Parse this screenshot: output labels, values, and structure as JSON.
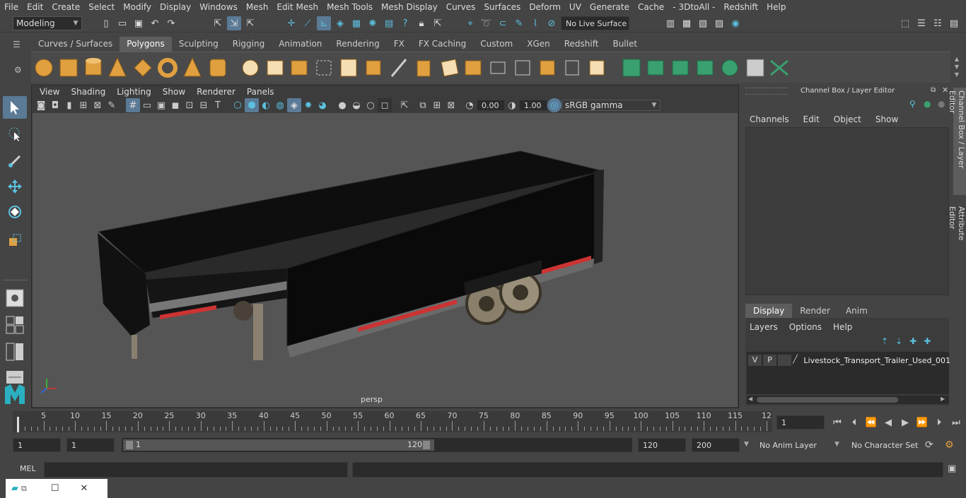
{
  "menubar": {
    "items": [
      "File",
      "Edit",
      "Create",
      "Select",
      "Modify",
      "Display",
      "Windows",
      "Mesh",
      "Edit Mesh",
      "Mesh Tools",
      "Mesh Display",
      "Curves",
      "Surfaces",
      "Deform",
      "UV",
      "Generate",
      "Cache",
      "- 3DtoAll -",
      "Redshift",
      "Help"
    ]
  },
  "statusline": {
    "mode": "Modeling",
    "live_surface": "No Live Surface"
  },
  "shelf": {
    "tabs": [
      "Curves / Surfaces",
      "Polygons",
      "Sculpting",
      "Rigging",
      "Animation",
      "Rendering",
      "FX",
      "FX Caching",
      "Custom",
      "XGen",
      "Redshift",
      "Bullet"
    ],
    "active_tab": "Polygons"
  },
  "viewport": {
    "menu": [
      "View",
      "Shading",
      "Lighting",
      "Show",
      "Renderer",
      "Panels"
    ],
    "exposure": "0.00",
    "gamma": "1.00",
    "color_space": "sRGB gamma",
    "camera": "persp"
  },
  "channel_box": {
    "title": "Channel Box / Layer Editor",
    "menu": [
      "Channels",
      "Edit",
      "Object",
      "Show"
    ],
    "tabs": [
      "Display",
      "Render",
      "Anim"
    ],
    "active_tab": "Display",
    "layer_menu": [
      "Layers",
      "Options",
      "Help"
    ],
    "layer": {
      "v": "V",
      "p": "P",
      "name": "Livestock_Transport_Trailer_Used_001"
    }
  },
  "side_tabs": [
    "Channel Box / Layer Editor",
    "Attribute Editor"
  ],
  "timeline": {
    "ticks": [
      "5",
      "10",
      "15",
      "20",
      "25",
      "30",
      "35",
      "40",
      "45",
      "50",
      "55",
      "60",
      "65",
      "70",
      "75",
      "80",
      "85",
      "90",
      "95",
      "100",
      "105",
      "110",
      "115",
      "12"
    ],
    "start_marker": "1",
    "current_frame": "1"
  },
  "range": {
    "start": "1",
    "playback_start": "1",
    "slider_start": "1",
    "slider_end": "120",
    "playback_end": "120",
    "end": "200",
    "anim_layer": "No Anim Layer",
    "character_set": "No Character Set"
  },
  "command": {
    "label": "MEL"
  },
  "colors": {
    "accent": "#5a7a96",
    "icon_orange": "#e0a040",
    "icon_green": "#3aa070",
    "icon_cyan": "#5bc0de"
  }
}
